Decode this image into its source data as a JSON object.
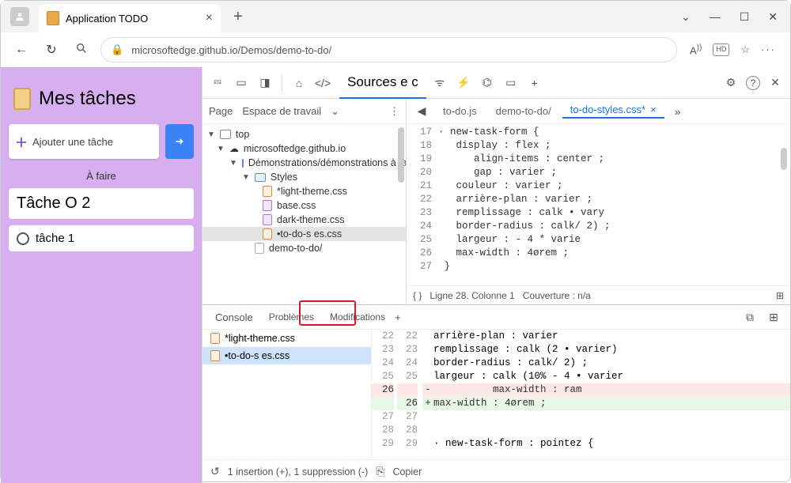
{
  "tab": {
    "title": "Application TODO"
  },
  "url": "microsoftedge.github.io/Demos/demo-to-do/",
  "toolbar_right": {
    "font": "A",
    "hd": "HD"
  },
  "app": {
    "title": "Mes tâches",
    "add_placeholder": "Ajouter une tâche",
    "section": "À faire",
    "tasks": [
      "Tâche O 2",
      "tâche 1"
    ]
  },
  "devtools": {
    "active_panel": "Sources e c",
    "page": "Page",
    "workspace": "Espace de travail",
    "tree": {
      "top": "top",
      "host": "microsoftedge.github.io",
      "demos": "Démonstrations/démonstrations à faire",
      "styles": "Styles",
      "files": [
        "*light-theme.css",
        "base.css",
        "dark-theme.css",
        "•to-do-s es.css"
      ],
      "demo": "demo-to-do/"
    },
    "file_tabs": {
      "a": "to-do.js",
      "b": "demo-to-do/",
      "c": "to-do-styles.css*"
    },
    "code_start": 17,
    "code_lines": [
      "· new-task-form {",
      "   display : flex ;",
      "      align-items : center ;",
      "      gap : varier ;",
      "   couleur : varier ;",
      "   arrière-plan : varier ;",
      "   remplissage : calk • vary",
      "   border-radius : calk/ 2) ;",
      "   largeur : - 4 * varie",
      "   max-width : 4ørem ;",
      " }"
    ],
    "status": {
      "braces": "{ }",
      "line": "Ligne 28. Colonne 1",
      "cov": "Couverture : n/a"
    },
    "drawer": {
      "tabs": [
        "Console",
        "Problèmes",
        "Modifications"
      ],
      "files": [
        "*light-theme.css",
        "•to-do-s es.css"
      ],
      "diff_left_start": 22,
      "diff_rows": [
        {
          "l": "22",
          "r": "22",
          "s": "",
          "t": "arrière-plan : varier",
          "cls": ""
        },
        {
          "l": "23",
          "r": "23",
          "s": "",
          "t": "remplissage : calk (2 • varier)",
          "cls": ""
        },
        {
          "l": "24",
          "r": "24",
          "s": "",
          "t": "border-radius : calk/ 2) ;",
          "cls": ""
        },
        {
          "l": "25",
          "r": "25",
          "s": "",
          "t": "largeur : calk (10% - 4 • varier",
          "cls": ""
        },
        {
          "l": "26",
          "r": "",
          "s": "-",
          "t": "          max-width : ram",
          "cls": "dl-del"
        },
        {
          "l": "",
          "r": "26",
          "s": "+",
          "t": "max-width : 4ørem ;",
          "cls": "dl-add"
        },
        {
          "l": "27",
          "r": "27",
          "s": "",
          "t": "",
          "cls": ""
        },
        {
          "l": "28",
          "r": "28",
          "s": "",
          "t": "",
          "cls": ""
        },
        {
          "l": "29",
          "r": "29",
          "s": "",
          "t": "· new-task-form : pointez {",
          "cls": ""
        }
      ],
      "status": "1 insertion (+), 1 suppression (-)",
      "copy": "Copier"
    }
  }
}
